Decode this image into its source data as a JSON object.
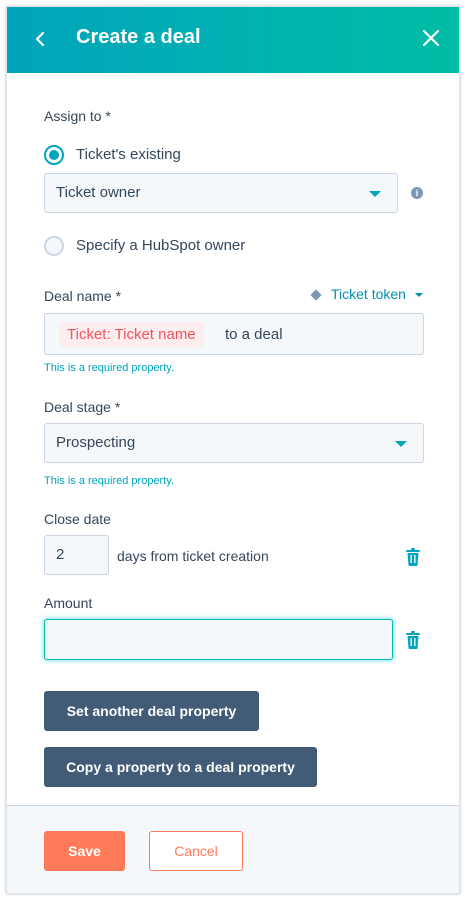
{
  "header": {
    "title": "Create a deal",
    "back_icon": "chevron-left-icon",
    "close_icon": "close-icon"
  },
  "assign_to": {
    "label": "Assign to *",
    "options": [
      {
        "label": "Ticket's existing",
        "checked": true
      },
      {
        "label": "Specify a HubSpot owner",
        "checked": false
      }
    ],
    "owner_select": {
      "value": "Ticket owner"
    }
  },
  "deal_name": {
    "label": "Deal name *",
    "token_link": "Ticket token",
    "token_chip": "Ticket: Ticket name",
    "suffix_text": "to a deal",
    "hint": "This is a required property."
  },
  "deal_stage": {
    "label": "Deal stage *",
    "value": "Prospecting",
    "hint": "This is a required property."
  },
  "close_date": {
    "label": "Close date",
    "value": "2",
    "suffix_text": "days from ticket creation"
  },
  "amount": {
    "label": "Amount",
    "value": ""
  },
  "buttons": {
    "set_another": "Set another deal property",
    "copy_property": "Copy a property to a deal property",
    "save": "Save",
    "cancel": "Cancel"
  },
  "colors": {
    "header_gradient_start": "#00a4bd",
    "header_gradient_end": "#00bda5",
    "accent": "#00a4bd",
    "link": "#0091ae",
    "token_chip_text": "#f2545b",
    "save": "#ff7a59",
    "dark_button": "#425b76"
  }
}
